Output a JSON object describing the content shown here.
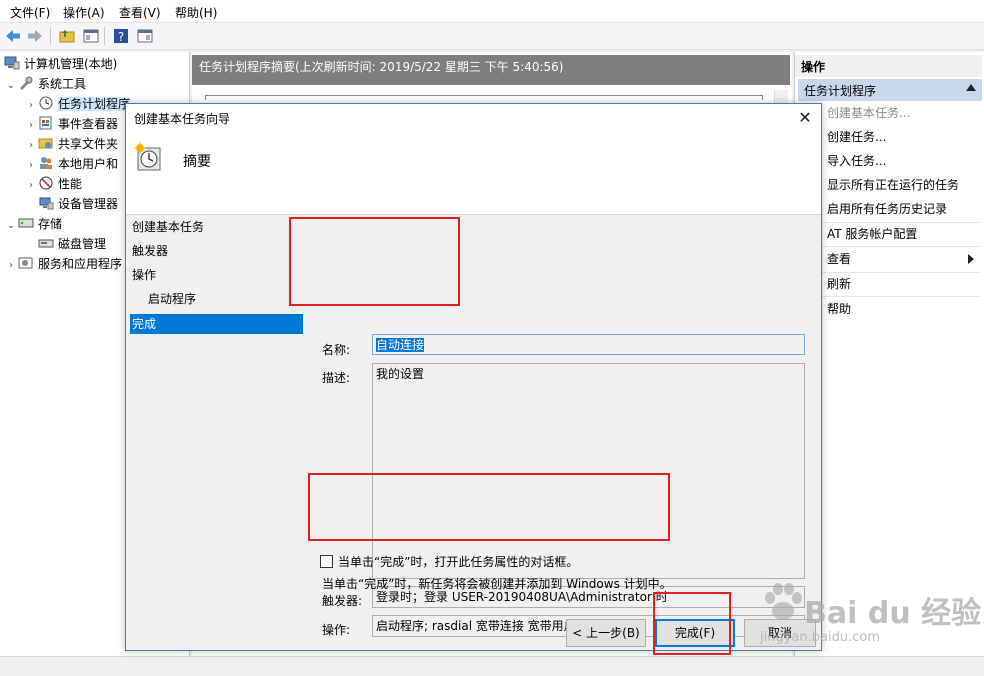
{
  "menu": [
    "文件(F)",
    "操作(A)",
    "查看(V)",
    "帮助(H)"
  ],
  "tree": {
    "root": "计算机管理(本地)",
    "system_tools": "系统工具",
    "task_scheduler": "任务计划程序",
    "event_viewer": "事件查看器",
    "shared_folders": "共享文件夹",
    "local_users": "本地用户和",
    "performance": "性能",
    "device_manager": "设备管理器",
    "storage": "存储",
    "disk_management": "磁盘管理",
    "services_apps": "服务和应用程序"
  },
  "summary_bar": "任务计划程序摘要(上次刷新时间: 2019/5/22 星期三 下午 5:40:56)",
  "actions": {
    "title": "操作",
    "group": "任务计划程序",
    "items": [
      "创建基本任务...",
      "创建任务...",
      "导入任务...",
      "显示所有正在运行的任务",
      "启用所有任务历史记录",
      "AT 服务帐户配置",
      "查看",
      "刷新",
      "帮助"
    ]
  },
  "dialog": {
    "title": "创建基本任务向导",
    "header_title": "摘要",
    "close_glyph": "✕",
    "steps": [
      "创建基本任务",
      "触发器",
      "操作",
      "启动程序",
      "完成"
    ],
    "name_label": "名称:",
    "name_value": "自动连接",
    "desc_label": "描述:",
    "desc_value": "我的设置",
    "trigger_label": "触发器:",
    "trigger_value": "登录时；登录 USER-20190408UA\\Administrator 时",
    "action_label": "操作:",
    "action_value": "启动程序; rasdial 宽带连接 宽带用户名 宽带密码;",
    "checkbox_label": "当单击“完成”时，打开此任务属性的对话框。",
    "info_text": "当单击“完成”时，新任务将会被创建并添加到 Windows 计划中。",
    "back_button": "< 上一步(B)",
    "finish_button": "完成(F)",
    "cancel_button": "取消"
  },
  "watermark": {
    "brand": "Bai du 经验",
    "url": "jingyan.baidu.com"
  },
  "colors": {
    "highlight": "#0078d7",
    "annotation": "#e51e1e",
    "summary_bar": "#7e7e7e",
    "actions_group": "#c8d8ec"
  }
}
